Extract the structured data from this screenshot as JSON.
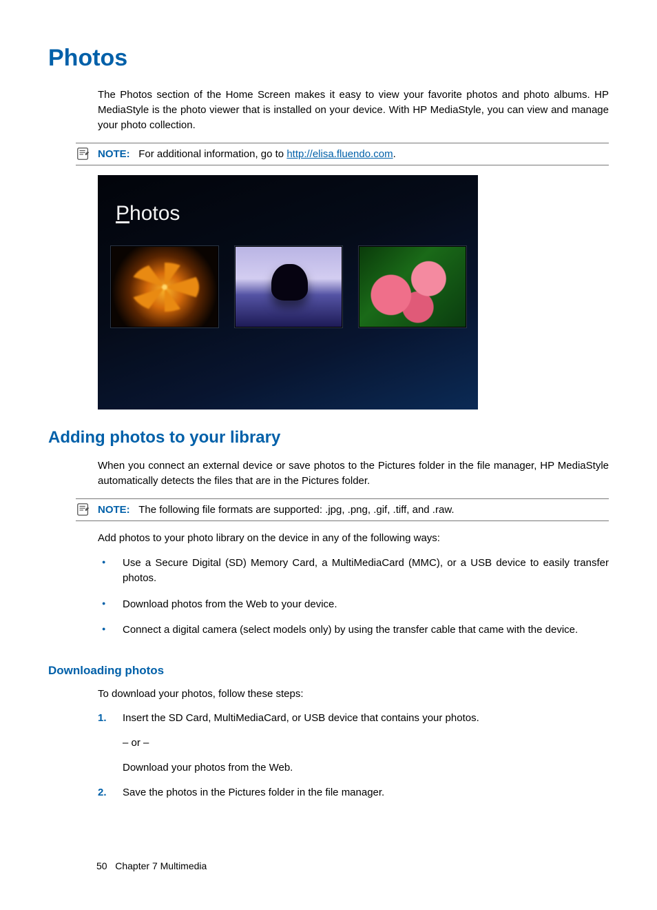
{
  "title": "Photos",
  "intro": "The Photos section of the Home Screen makes it easy to view your favorite photos and photo albums. HP MediaStyle is the photo viewer that is installed on your device. With HP MediaStyle, you can view and manage your photo collection.",
  "note1": {
    "label": "NOTE:",
    "text_before": "For additional information, go to ",
    "link_text": "http://elisa.fluendo.com",
    "link_href": "http://elisa.fluendo.com",
    "text_after": "."
  },
  "screenshot_title_first": "P",
  "screenshot_title_rest": "hotos",
  "section_adding": "Adding photos to your library",
  "adding_p1": "When you connect an external device or save photos to the Pictures folder in the file manager, HP MediaStyle automatically detects the files that are in the Pictures folder.",
  "note2": {
    "label": "NOTE:",
    "text": "The following file formats are supported: .jpg, .png, .gif, .tiff, and .raw."
  },
  "adding_p2": "Add photos to your photo library on the device in any of the following ways:",
  "bullets": [
    "Use a Secure Digital (SD) Memory Card, a MultiMediaCard (MMC), or a USB device to easily transfer photos.",
    "Download photos from the Web to your device.",
    "Connect a digital camera (select models only) by using the transfer cable that came with the device."
  ],
  "section_download": "Downloading photos",
  "download_p1": "To download your photos, follow these steps:",
  "steps": [
    {
      "lines": [
        "Insert the SD Card, MultiMediaCard, or USB device that contains your photos.",
        "– or –",
        "Download your photos from the Web."
      ]
    },
    {
      "lines": [
        "Save the photos in the Pictures folder in the file manager."
      ]
    }
  ],
  "footer": {
    "page": "50",
    "chapter": "Chapter 7   Multimedia"
  }
}
